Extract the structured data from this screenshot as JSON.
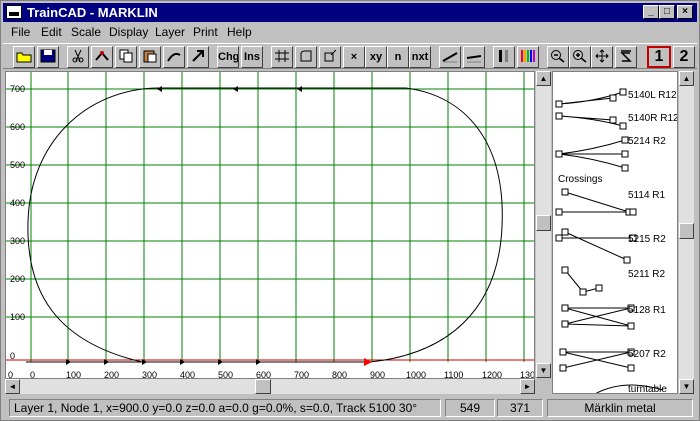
{
  "window": {
    "title": "TrainCAD - MARKLIN",
    "buttons": {
      "minimize": "_",
      "maximize": "□",
      "close": "×"
    }
  },
  "menu": [
    "File",
    "Edit",
    "Scale",
    "Display",
    "Layer",
    "Print",
    "Help"
  ],
  "toolbar": {
    "change_label": "Chg",
    "insert_label": "Ins",
    "delete_label": "×",
    "xy_label": "xy",
    "n_label": "n",
    "nxt_label": "nxt",
    "layer1_label": "1",
    "layer2_label": "2"
  },
  "canvas": {
    "y_ticks": [
      "700",
      "600",
      "500",
      "400",
      "300",
      "200",
      "100",
      "0"
    ],
    "x_ticks": [
      "0",
      "0",
      "100",
      "200",
      "300",
      "400",
      "500",
      "600",
      "700",
      "800",
      "900",
      "1000",
      "1100",
      "1200",
      "130"
    ],
    "grid_color": "#008000",
    "track_color": "#000000",
    "axis_color": "#c00000",
    "cursor_color": "#ff0000"
  },
  "palette": {
    "items": [
      "5140L R12",
      "5140R R12",
      "5214  R2",
      "Crossings",
      "5114 R1",
      "5215 R2",
      "5211 R2",
      "5128 R1",
      "5207 R2",
      "turntable"
    ]
  },
  "status": {
    "info": "Layer 1, Node 1, x=900.0 y=0.0 z=0.0 a=0.0 g=0.0%, s=0.0, Track 5100 30°",
    "coord_x": "549",
    "coord_y": "371",
    "library": "Märklin metal"
  }
}
